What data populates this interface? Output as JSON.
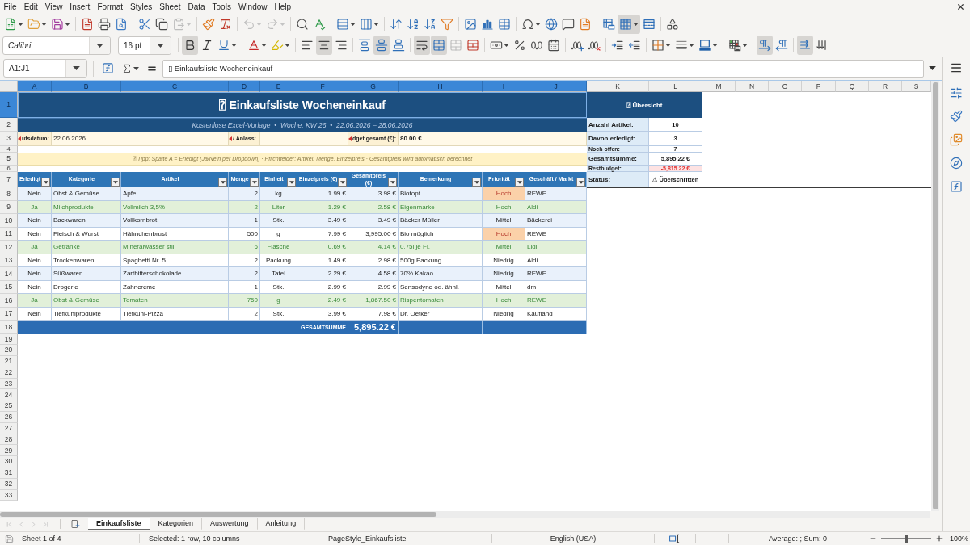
{
  "menu": [
    "File",
    "Edit",
    "View",
    "Insert",
    "Format",
    "Styles",
    "Sheet",
    "Data",
    "Tools",
    "Window",
    "Help"
  ],
  "standard_toolbar": [
    [
      {
        "kind": "new",
        "active": false,
        "disabled": false
      },
      {
        "kind": "open",
        "active": false,
        "disabled": false
      },
      {
        "kind": "save",
        "active": false,
        "disabled": false
      }
    ],
    [
      {
        "kind": "export-pdf",
        "active": false,
        "disabled": false
      },
      {
        "kind": "print",
        "active": false,
        "disabled": false
      },
      {
        "kind": "print-preview",
        "active": false,
        "disabled": false
      }
    ],
    [
      {
        "kind": "cut",
        "active": false,
        "disabled": false
      },
      {
        "kind": "copy",
        "active": false,
        "disabled": false
      },
      {
        "kind": "paste",
        "active": false,
        "disabled": true
      }
    ],
    [
      {
        "kind": "clone",
        "active": false,
        "disabled": false
      },
      {
        "kind": "clear-formatting",
        "active": false,
        "disabled": false
      }
    ],
    [
      {
        "kind": "undo",
        "active": false,
        "disabled": true
      },
      {
        "kind": "redo",
        "active": false,
        "disabled": true
      }
    ],
    [
      {
        "kind": "find-replace",
        "active": false,
        "disabled": false
      },
      {
        "kind": "spelling",
        "active": false,
        "disabled": false
      }
    ],
    [
      {
        "kind": "row",
        "active": false,
        "disabled": false
      },
      {
        "kind": "column",
        "active": false,
        "disabled": false
      }
    ],
    [
      {
        "kind": "sort",
        "active": false,
        "disabled": false
      },
      {
        "kind": "sort-ascending",
        "active": false,
        "disabled": false
      },
      {
        "kind": "sort-descending",
        "active": false,
        "disabled": false
      },
      {
        "kind": "autofilter",
        "active": false,
        "disabled": false
      }
    ],
    [
      {
        "kind": "image",
        "active": false,
        "disabled": false
      },
      {
        "kind": "chart",
        "active": false,
        "disabled": false
      },
      {
        "kind": "pivot-table",
        "active": false,
        "disabled": false
      }
    ],
    [
      {
        "kind": "special-character",
        "active": false,
        "disabled": false
      },
      {
        "kind": "hyperlink",
        "active": false,
        "disabled": false
      },
      {
        "kind": "comment",
        "active": false,
        "disabled": false
      },
      {
        "kind": "header-footer",
        "active": false,
        "disabled": false
      }
    ],
    [
      {
        "kind": "print-area",
        "active": false,
        "disabled": false
      },
      {
        "kind": "freeze",
        "active": true,
        "disabled": false
      },
      {
        "kind": "split-window",
        "active": false,
        "disabled": false
      }
    ],
    [
      {
        "kind": "shapes",
        "active": false,
        "disabled": false
      }
    ]
  ],
  "formatting_toolbar": {
    "font_name": "Calibri",
    "font_size": "16 pt",
    "groups": [
      [
        {
          "kind": "bold",
          "active": true,
          "disabled": false
        },
        {
          "kind": "italic",
          "active": false,
          "disabled": false
        },
        {
          "kind": "underline",
          "active": false,
          "disabled": false
        }
      ],
      [
        {
          "kind": "font-color",
          "active": false,
          "disabled": false
        },
        {
          "kind": "highlight",
          "active": false,
          "disabled": false
        }
      ],
      [
        {
          "kind": "align-left",
          "active": false,
          "disabled": false
        },
        {
          "kind": "align-center",
          "active": true,
          "disabled": false
        },
        {
          "kind": "align-right",
          "active": false,
          "disabled": false
        }
      ],
      [
        {
          "kind": "align-top",
          "active": false,
          "disabled": false
        },
        {
          "kind": "align-middle",
          "active": true,
          "disabled": false
        },
        {
          "kind": "align-bottom",
          "active": false,
          "disabled": false
        }
      ],
      [
        {
          "kind": "wrap-text",
          "active": true,
          "disabled": false
        },
        {
          "kind": "merge-center",
          "active": true,
          "disabled": false
        },
        {
          "kind": "merge",
          "active": false,
          "disabled": true
        },
        {
          "kind": "unmerge",
          "active": false,
          "disabled": false
        }
      ],
      [
        {
          "kind": "currency",
          "active": false,
          "disabled": false
        },
        {
          "kind": "percent",
          "active": false,
          "disabled": false
        },
        {
          "kind": "number",
          "active": false,
          "disabled": false
        },
        {
          "kind": "date",
          "active": false,
          "disabled": false
        }
      ],
      [
        {
          "kind": "add-decimal",
          "active": false,
          "disabled": false
        },
        {
          "kind": "delete-decimal",
          "active": false,
          "disabled": false
        }
      ],
      [
        {
          "kind": "indent-increase",
          "active": false,
          "disabled": false
        },
        {
          "kind": "indent-decrease",
          "active": false,
          "disabled": false
        }
      ],
      [
        {
          "kind": "borders",
          "active": false,
          "disabled": false
        },
        {
          "kind": "border-style",
          "active": false,
          "disabled": false
        },
        {
          "kind": "border-color",
          "active": false,
          "disabled": false
        }
      ],
      [
        {
          "kind": "conditional",
          "active": false,
          "disabled": false
        }
      ],
      [
        {
          "kind": "ltr",
          "active": true,
          "disabled": false
        },
        {
          "kind": "rtl",
          "active": false,
          "disabled": false
        }
      ],
      [
        {
          "kind": "text-ltr",
          "active": true,
          "disabled": false
        },
        {
          "kind": "text-ttb",
          "active": false,
          "disabled": false
        }
      ]
    ]
  },
  "formula_bar": {
    "name_box": "A1:J1",
    "formula": "▯ Einkaufsliste Wocheneinkauf"
  },
  "sheet": {
    "columns": [
      {
        "label": "A",
        "selected": true
      },
      {
        "label": "B",
        "selected": true
      },
      {
        "label": "C",
        "selected": true
      },
      {
        "label": "D",
        "selected": true
      },
      {
        "label": "E",
        "selected": true
      },
      {
        "label": "F",
        "selected": true
      },
      {
        "label": "G",
        "selected": true
      },
      {
        "label": "H",
        "selected": true
      },
      {
        "label": "I",
        "selected": true
      },
      {
        "label": "J",
        "selected": true
      },
      {
        "label": "K",
        "selected": false
      },
      {
        "label": "L",
        "selected": false
      },
      {
        "label": "M",
        "selected": false
      },
      {
        "label": "N",
        "selected": false
      },
      {
        "label": "O",
        "selected": false
      },
      {
        "label": "P",
        "selected": false
      },
      {
        "label": "Q",
        "selected": false
      },
      {
        "label": "R",
        "selected": false
      },
      {
        "label": "S",
        "selected": false
      }
    ],
    "rows": [
      {
        "label": "1",
        "selected": true
      },
      {
        "label": "2",
        "selected": false
      },
      {
        "label": "3",
        "selected": false
      },
      {
        "label": "4",
        "selected": false
      },
      {
        "label": "5",
        "selected": false
      },
      {
        "label": "6",
        "selected": false
      },
      {
        "label": "7",
        "selected": false
      },
      {
        "label": "8",
        "selected": false
      },
      {
        "label": "9",
        "selected": false
      },
      {
        "label": "10",
        "selected": false
      },
      {
        "label": "11",
        "selected": false
      },
      {
        "label": "12",
        "selected": false
      },
      {
        "label": "13",
        "selected": false
      },
      {
        "label": "14",
        "selected": false
      },
      {
        "label": "15",
        "selected": false
      },
      {
        "label": "16",
        "selected": false
      },
      {
        "label": "17",
        "selected": false
      },
      {
        "label": "18",
        "selected": false
      },
      {
        "label": "19",
        "selected": false
      },
      {
        "label": "20",
        "selected": false
      },
      {
        "label": "21",
        "selected": false
      },
      {
        "label": "22",
        "selected": false
      },
      {
        "label": "23",
        "selected": false
      },
      {
        "label": "24",
        "selected": false
      },
      {
        "label": "25",
        "selected": false
      },
      {
        "label": "26",
        "selected": false
      },
      {
        "label": "27",
        "selected": false
      },
      {
        "label": "28",
        "selected": false
      },
      {
        "label": "29",
        "selected": false
      },
      {
        "label": "30",
        "selected": false
      },
      {
        "label": "31",
        "selected": false
      },
      {
        "label": "32",
        "selected": false
      },
      {
        "label": "33",
        "selected": false
      }
    ],
    "title": "⍰ Einkaufsliste Wocheneinkauf",
    "subtitle": "Kostenlose Excel-Vorlage  •  Woche: KW 26  •  22.06.2026 – 28.06.2026",
    "details": [
      {
        "label": "ufsdatum:",
        "clipped": true,
        "value": "22.06.2026"
      },
      {
        "label": "/ Anlass:",
        "clipped": true
      },
      {
        "label": "dget gesamt (€):",
        "clipped": true,
        "value": "80.00 €"
      }
    ],
    "tip": "⍰ Tipp: Spalte A = Erledigt (Ja/Nein per Dropdown) · Pflichtfelder: Artikel, Menge, Einzelpreis · Gesamtpreis wird automatisch berechnet",
    "table": {
      "columns": [
        "Erledigt",
        "Kategorie",
        "Artikel",
        "Menge",
        "Einheit",
        "Einzelpreis (€)",
        "Gesamtpreis (€)",
        "Bemerkung",
        "Priorität",
        "Geschäft / Markt"
      ],
      "rows": [
        {
          "cells": [
            "Nein",
            "Obst & Gemüse",
            "Äpfel",
            "2",
            "kg",
            "1.99 €",
            "3.98 €",
            "Biotopf",
            "Hoch",
            "REWE"
          ],
          "done": false,
          "urgent": true
        },
        {
          "cells": [
            "Ja",
            "Milchprodukte",
            "Vollmilch 3,5%",
            "2",
            "Liter",
            "1.29 €",
            "2.58 €",
            "Eigenmarke",
            "Hoch",
            "Aldi"
          ],
          "done": true,
          "urgent": false
        },
        {
          "cells": [
            "Nein",
            "Backwaren",
            "Vollkornbrot",
            "1",
            "Stk.",
            "3.49 €",
            "3.49 €",
            "Bäcker Müller",
            "Mittel",
            "Bäckerei"
          ],
          "done": false,
          "urgent": false
        },
        {
          "cells": [
            "Nein",
            "Fleisch & Wurst",
            "Hähnchenbrust",
            "500",
            "g",
            "7.99 €",
            "3,995.00 €",
            "Bio möglich",
            "Hoch",
            "REWE"
          ],
          "done": false,
          "urgent": true
        },
        {
          "cells": [
            "Ja",
            "Getränke",
            "Mineralwasser still",
            "6",
            "Flasche",
            "0.69 €",
            "4.14 €",
            "0,75l je Fl.",
            "Mittel",
            "Lidl"
          ],
          "done": true,
          "urgent": false
        },
        {
          "cells": [
            "Nein",
            "Trockenwaren",
            "Spaghetti Nr. 5",
            "2",
            "Packung",
            "1.49 €",
            "2.98 €",
            "500g Packung",
            "Niedrig",
            "Aldi"
          ],
          "done": false,
          "urgent": false
        },
        {
          "cells": [
            "Nein",
            "Süßwaren",
            "Zartbitterschokolade",
            "2",
            "Tafel",
            "2.29 €",
            "4.58 €",
            "70% Kakao",
            "Niedrig",
            "REWE"
          ],
          "done": false,
          "urgent": false
        },
        {
          "cells": [
            "Nein",
            "Drogerie",
            "Zahncreme",
            "1",
            "Stk.",
            "2.99 €",
            "2.99 €",
            "Sensodyne od. ähnl.",
            "Mittel",
            "dm"
          ],
          "done": false,
          "urgent": false
        },
        {
          "cells": [
            "Ja",
            "Obst & Gemüse",
            "Tomaten",
            "750",
            "g",
            "2.49 €",
            "1,867.50 €",
            "Rispentomaten",
            "Hoch",
            "REWE"
          ],
          "done": true,
          "urgent": false
        },
        {
          "cells": [
            "Nein",
            "Tiefkühlprodukte",
            "Tiefkühl-Pizza",
            "2",
            "Stk.",
            "3.99 €",
            "7.98 €",
            "Dr. Oetker",
            "Niedrig",
            "Kaufland"
          ],
          "done": false,
          "urgent": false
        }
      ],
      "total": {
        "label": "GESAMTSUMME",
        "value": "5,895.22 €"
      }
    },
    "summary": {
      "title": "⍰ Übersicht",
      "rows": [
        {
          "label": "Anzahl Artikel:",
          "value": "10",
          "alert": false
        },
        {
          "label": "Davon erledigt:",
          "value": "3",
          "alert": false
        },
        {
          "label": "Noch offen:",
          "value": "7",
          "alert": false
        },
        {
          "label": "Gesamtsumme:",
          "value": "5,895.22 €",
          "alert": false
        },
        {
          "label": "Restbudget:",
          "value": "-5,815.22 €",
          "alert": true
        },
        {
          "label": "Status:",
          "value": "⚠ Überschritten",
          "alert": false
        }
      ]
    }
  },
  "sheet_navigation": [
    {
      "kind": "first",
      "disabled": true
    },
    {
      "kind": "previous",
      "disabled": true
    },
    {
      "kind": "next",
      "disabled": true
    },
    {
      "kind": "last",
      "disabled": true
    }
  ],
  "sheet_tabs": [
    {
      "label": "Einkaufsliste",
      "selected": true
    },
    {
      "label": "Kategorien",
      "selected": false
    },
    {
      "label": "Auswertung",
      "selected": false
    },
    {
      "label": "Anleitung",
      "selected": false
    }
  ],
  "status_bar": {
    "sheet": "Sheet 1 of 4",
    "selection": "Selected: 1 row, 10 columns",
    "page_style": "PageStyle_Einkaufsliste",
    "language": "English (USA)",
    "statistics": "Average: ; Sum: 0",
    "zoom": {
      "level": 0.5,
      "reading": "100%"
    }
  }
}
